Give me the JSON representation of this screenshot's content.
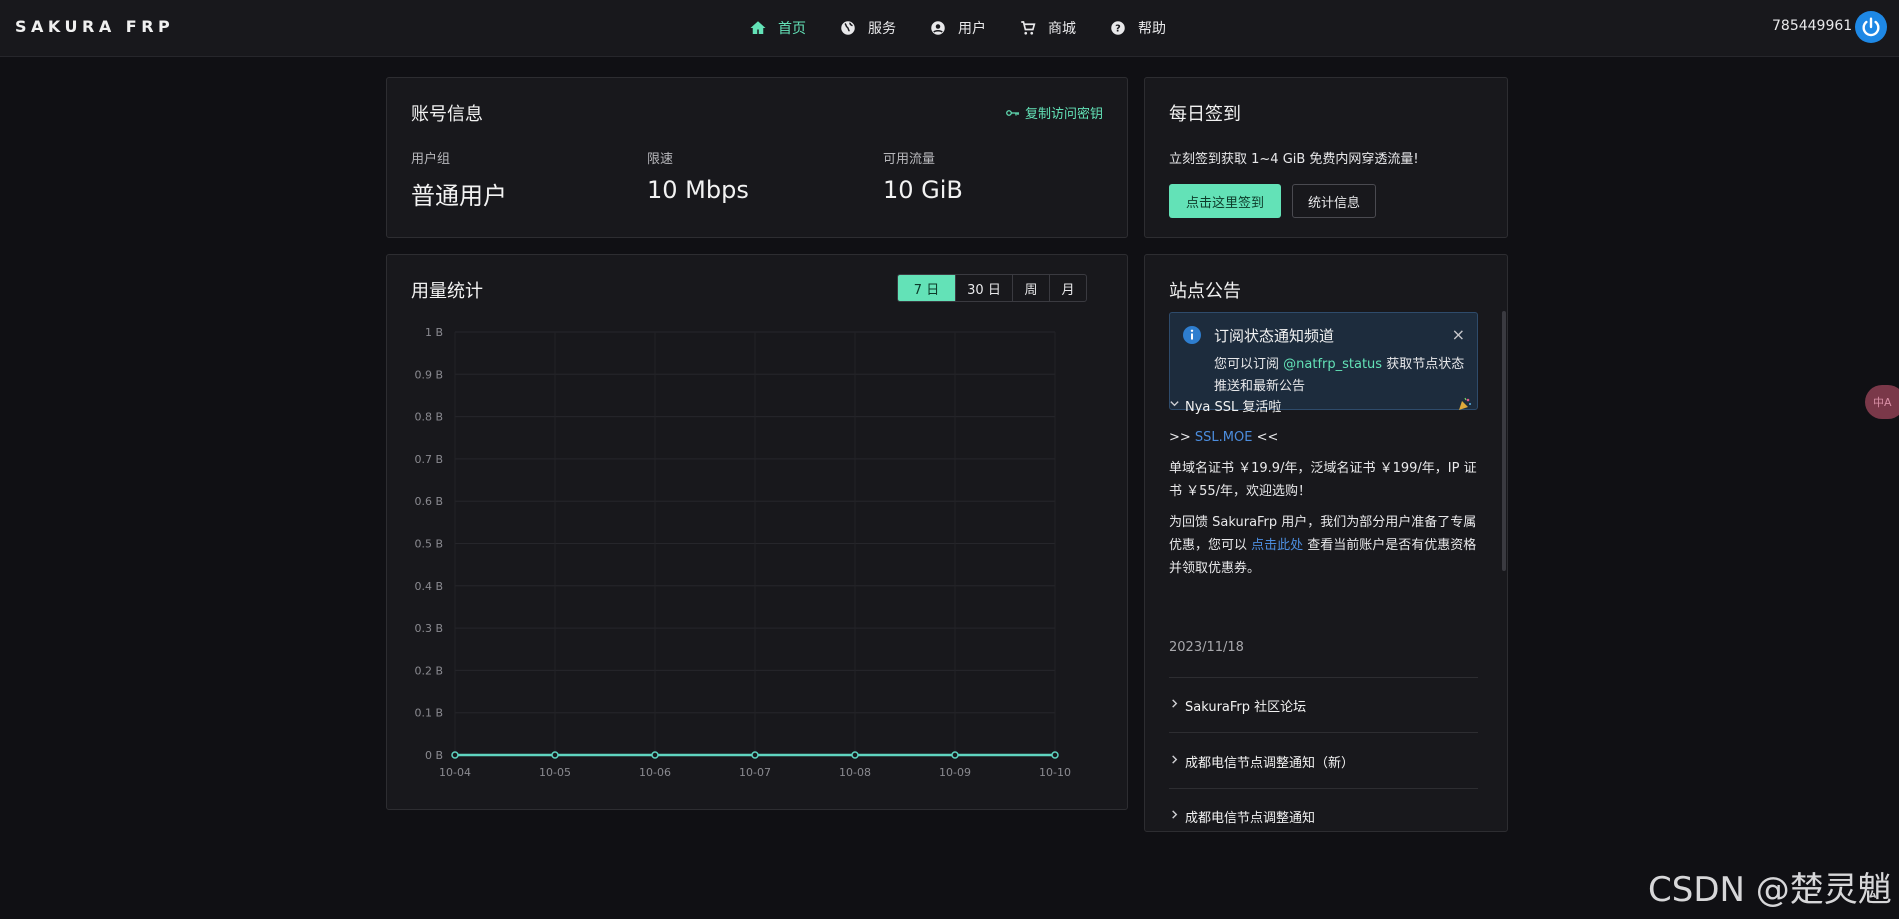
{
  "topbar": {
    "brand": "SAKURA FRP",
    "nav": [
      {
        "label": "首页",
        "icon": "home-icon",
        "active": true
      },
      {
        "label": "服务",
        "icon": "globe-icon",
        "active": false
      },
      {
        "label": "用户",
        "icon": "user-icon",
        "active": false
      },
      {
        "label": "商城",
        "icon": "cart-icon",
        "active": false
      },
      {
        "label": "帮助",
        "icon": "help-icon",
        "active": false
      }
    ],
    "user_id": "785449961",
    "power_icon": "power-icon"
  },
  "account": {
    "title": "账号信息",
    "copy_key": "复制访问密钥",
    "stats": [
      {
        "label": "用户组",
        "value": "普通用户"
      },
      {
        "label": "限速",
        "value": "10 Mbps"
      },
      {
        "label": "可用流量",
        "value": "10 GiB"
      }
    ]
  },
  "checkin": {
    "title": "每日签到",
    "desc": "立刻签到获取 1~4 GiB 免费内网穿透流量!",
    "checkin_button": "点击这里签到",
    "stats_button": "统计信息"
  },
  "usage": {
    "title": "用量统计",
    "ranges": [
      {
        "label": "7 日",
        "active": true
      },
      {
        "label": "30 日",
        "active": false
      },
      {
        "label": "周",
        "active": false
      },
      {
        "label": "月",
        "active": false
      }
    ]
  },
  "chart_data": {
    "type": "line",
    "title": "",
    "xlabel": "",
    "ylabel": "",
    "x": [
      "10-04",
      "10-05",
      "10-06",
      "10-07",
      "10-08",
      "10-09",
      "10-10"
    ],
    "series": [
      {
        "values": [
          0,
          0,
          0,
          0,
          0,
          0,
          0
        ]
      }
    ],
    "y_ticks": [
      "0 B",
      "0.1 B",
      "0.2 B",
      "0.3 B",
      "0.4 B",
      "0.5 B",
      "0.6 B",
      "0.7 B",
      "0.8 B",
      "0.9 B",
      "1 B"
    ],
    "ylim": [
      0,
      1
    ],
    "grid": true,
    "line_color": "#5fd4c0"
  },
  "notices": {
    "title": "站点公告",
    "alert": {
      "title": "订阅状态通知频道",
      "body_prefix": "您可以订阅 ",
      "link": "@natfrp_status",
      "body_suffix": " 获取节点状态推送和最新公告",
      "close": "×"
    },
    "expanded": {
      "title": "Nya SSL 复活啦",
      "party_icon": "party-popper-icon",
      "line1_prefix": ">> ",
      "line1_link": "SSL.MOE",
      "line1_suffix": " <<",
      "para1": "单域名证书 ￥19.9/年，泛域名证书 ￥199/年，IP 证书 ￥55/年，欢迎选购！",
      "para2_prefix": "为回馈 SakuraFrp 用户，我们为部分用户准备了专属优惠，您可以 ",
      "para2_link": "点击此处",
      "para2_suffix": " 查看当前账户是否有优惠资格并领取优惠券。",
      "date": "2023/11/18"
    },
    "collapsed": [
      "SakuraFrp 社区论坛",
      "成都电信节点调整通知（新）",
      "成都电信节点调整通知"
    ]
  },
  "translate_badge": "中A",
  "watermark": "CSDN @楚灵魈",
  "colors": {
    "accent": "#63e2b7",
    "info": "#2e7ecf",
    "link": "#4c8dde"
  }
}
